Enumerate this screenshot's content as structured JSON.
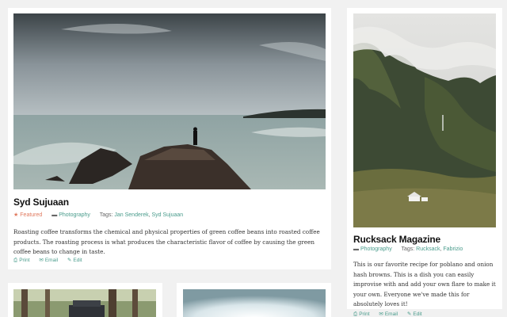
{
  "posts": [
    {
      "title": "Syd Sujuaan",
      "featured_label": "Featured",
      "category": "Photography",
      "tags_label": "Tags:",
      "tags": [
        "Jan Senderek",
        "Syd Sujuaan"
      ],
      "excerpt": "Roasting coffee transforms the chemical and physical properties of green coffee beans into roasted coffee products. The roasting process is what produces the characteristic flavor of coffee by causing the green coffee beans to change in taste.",
      "actions": {
        "print": "Print",
        "email": "Email",
        "edit": "Edit"
      }
    },
    {
      "title": "Rucksack Magazine",
      "category": "Photography",
      "tags_label": "Tags:",
      "tags": [
        "Rucksack",
        "Fabrizio"
      ],
      "excerpt": "This is our favorite recipe for poblano and onion hash browns. This is a dish you can easily improvise with and add your own flare to make it your own. Everyone we've made this for absolutely loves it!",
      "actions": {
        "print": "Print",
        "email": "Email",
        "edit": "Edit"
      }
    }
  ],
  "colors": {
    "accent": "#4a9c8c",
    "featured": "#e07a5f",
    "background": "#f1f1f1"
  },
  "icons": {
    "featured": "star-icon",
    "category": "folder-icon",
    "tags": "tag-icon",
    "print": "printer-icon",
    "email": "envelope-icon",
    "edit": "pencil-icon"
  }
}
